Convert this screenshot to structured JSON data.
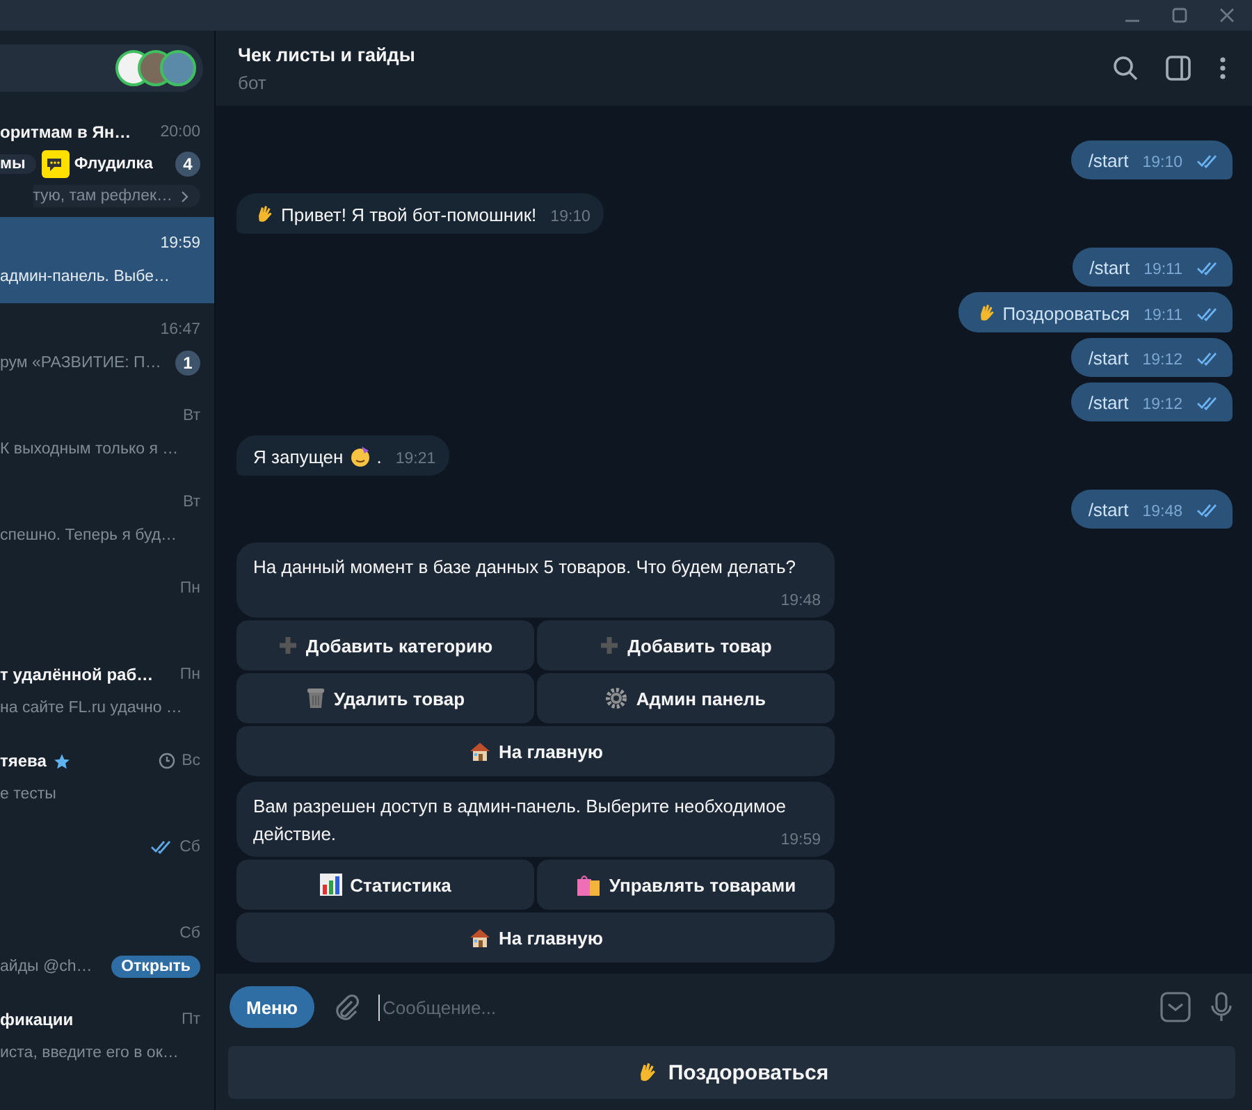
{
  "chat": {
    "title": "Чек листы и гайды",
    "subtitle": "бот"
  },
  "sidebar": {
    "rows": [
      {
        "title": "оритмам в Ян…",
        "time": "20:00",
        "topics": [
          {
            "label": "мы",
            "kind": "plain"
          },
          {
            "label": "Флудилка",
            "kind": "chat"
          }
        ],
        "unread": "4",
        "preview": "тую, там рефлек…",
        "selected": false
      },
      {
        "time": "19:59",
        "preview": "админ-панель. Выбе…",
        "selected": true
      },
      {
        "time": "16:47",
        "preview": "рум «РАЗВИТИЕ: П…",
        "unread": "1",
        "selected": false
      },
      {
        "time": "Вт",
        "preview": "К выходным только я …",
        "selected": false
      },
      {
        "time": "Вт",
        "preview": "спешно. Теперь я буд…",
        "selected": false
      },
      {
        "time": "Пн",
        "selected": false
      },
      {
        "title": "т удалённой раб…",
        "time": "Пн",
        "preview": "на сайте FL.ru удачно …",
        "selected": false
      },
      {
        "title": "тяева",
        "starred": true,
        "scheduled": true,
        "time": "Вс",
        "preview": "е тесты",
        "selected": false
      },
      {
        "read": true,
        "time": "Сб",
        "selected": false
      },
      {
        "time": "Сб",
        "preview": "айды @ch…",
        "action": "Открыть",
        "selected": false
      },
      {
        "title": "фикации",
        "time": "Пт",
        "preview": "иста, введите его в ок…",
        "selected": false
      }
    ]
  },
  "messages": [
    {
      "out": true,
      "kind": "plain",
      "text": "/start",
      "time": "19:10",
      "read": true
    },
    {
      "out": false,
      "kind": "wave",
      "text": "Привет! Я твой бот-помошник!",
      "time": "19:10"
    },
    {
      "out": true,
      "kind": "plain",
      "text": "/start",
      "time": "19:11",
      "read": true
    },
    {
      "out": true,
      "kind": "wave",
      "text": "Поздороваться",
      "time": "19:11",
      "read": true
    },
    {
      "out": true,
      "kind": "plain",
      "text": "/start",
      "time": "19:12",
      "read": true
    },
    {
      "out": true,
      "kind": "plain",
      "text": "/start",
      "time": "19:12",
      "read": true
    },
    {
      "out": false,
      "kind": "party",
      "text": "Я запущен",
      "suffix": ".",
      "time": "19:21"
    },
    {
      "out": true,
      "kind": "plain",
      "text": "/start",
      "time": "19:48",
      "read": true
    },
    {
      "out": false,
      "kind": "plain",
      "text": "На данный момент в базе данных 5 товаров. Что будем делать?",
      "time": "19:48",
      "keyboard": [
        [
          {
            "label": "Добавить категорию",
            "kind": "add"
          },
          {
            "label": "Добавить товар",
            "kind": "add"
          }
        ],
        [
          {
            "label": "Удалить товар",
            "kind": "trash"
          },
          {
            "label": "Админ панель",
            "kind": "gear"
          }
        ],
        [
          {
            "label": "На главную",
            "kind": "home"
          }
        ]
      ]
    },
    {
      "out": false,
      "kind": "plain",
      "text": "Вам разрешен доступ в админ-панель. Выберите необходимое действие.",
      "time": "19:59",
      "keyboard": [
        [
          {
            "label": "Статистика",
            "kind": "chart"
          },
          {
            "label": "Управлять товарами",
            "kind": "bags"
          }
        ],
        [
          {
            "label": "На главную",
            "kind": "home"
          }
        ]
      ]
    }
  ],
  "composer": {
    "menu": "Меню",
    "placeholder": "Сообщение..."
  },
  "reply_keyboard": [
    {
      "label": "Поздороваться",
      "kind": "wave"
    }
  ]
}
